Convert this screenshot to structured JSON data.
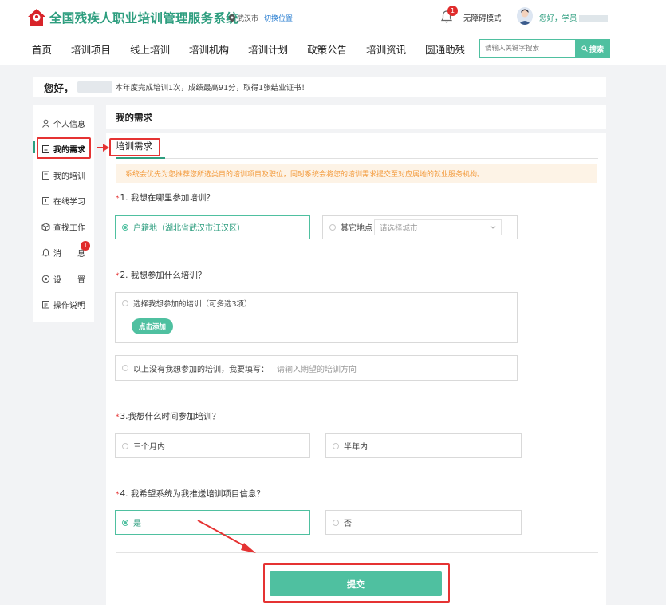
{
  "header": {
    "site_name": "全国残疾人职业培训管理服务系统",
    "city": "武汉市",
    "switch_location": "切换位置",
    "notification_count": "1",
    "accessible_mode": "无障碍模式",
    "greeting": "您好，学员"
  },
  "nav": {
    "items": [
      "首页",
      "培训项目",
      "线上培训",
      "培训机构",
      "培训计划",
      "政策公告",
      "培训资讯",
      "圆通助残"
    ],
    "search_placeholder": "请输入关键字搜索",
    "search_button": "搜索"
  },
  "welcome": {
    "hello": "您好，",
    "summary": "本年度完成培训1次，成绩最高91分，取得1张结业证书！"
  },
  "sidebar": {
    "items": [
      {
        "label": "个人信息",
        "icon": "user-icon"
      },
      {
        "label": "我的需求",
        "icon": "clipboard-icon"
      },
      {
        "label": "我的培训",
        "icon": "document-icon"
      },
      {
        "label": "在线学习",
        "icon": "book-icon"
      },
      {
        "label": "查找工作",
        "icon": "cube-icon"
      },
      {
        "label": "消　　息",
        "icon": "bell-icon"
      },
      {
        "label": "设　　置",
        "icon": "gear-icon"
      },
      {
        "label": "操作说明",
        "icon": "manual-icon"
      }
    ],
    "message_badge": "1",
    "active_index": 1
  },
  "main": {
    "title": "我的需求",
    "tab": "培训需求",
    "notice": "系统会优先为您推荐您所选类目的培训项目及职位，同时系统会将您的培训需求提交至对应属地的就业服务机构。",
    "q1": {
      "label": "1. 我想在哪里参加培训？",
      "opt_home": "户籍地（湖北省武汉市江汉区）",
      "opt_other": "其它地点",
      "city_placeholder": "请选择城市"
    },
    "q2": {
      "label": "2. 我想参加什么培训？",
      "multi_label": "选择我想参加的培训（可多选3项）",
      "add_button": "点击添加",
      "fill_label": "以上没有我想参加的培训，我要填写：",
      "fill_placeholder": "请输入期望的培训方向"
    },
    "q3": {
      "label": "3.我想什么时间参加培训？",
      "opt_a": "三个月内",
      "opt_b": "半年内"
    },
    "q4": {
      "label": "4. 我希望系统为我推送培训项目信息？",
      "opt_yes": "是",
      "opt_no": "否"
    },
    "submit": "提交"
  },
  "colors": {
    "brand": "#2e9e7f",
    "accent": "#4fc0a0",
    "highlight": "#e53333",
    "notice_text": "#f39a3b"
  }
}
